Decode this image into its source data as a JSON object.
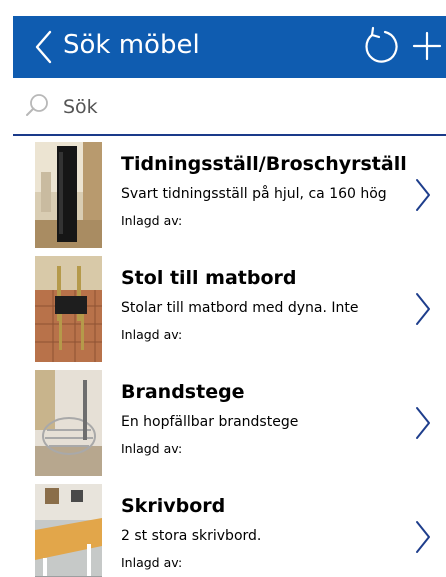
{
  "header": {
    "title": "Sök möbel",
    "bg_color": "#0f5cb0",
    "back_icon": "chevron-left-icon",
    "refresh_icon": "refresh-icon",
    "add_icon": "plus-icon"
  },
  "search": {
    "placeholder": "Sök",
    "value": ""
  },
  "items": [
    {
      "title": "Tidningsställ/Broschyrställ",
      "description": "Svart tidningsställ på hjul, ca 160 hög",
      "added_by": "Inlagd av:"
    },
    {
      "title": "Stol till matbord",
      "description": "Stolar till matbord med dyna. Inte",
      "added_by": "Inlagd av:"
    },
    {
      "title": "Brandstege",
      "description": "En hopfällbar brandstege",
      "added_by": "Inlagd av:"
    },
    {
      "title": "Skrivbord",
      "description": "2 st stora skrivbord.",
      "added_by": "Inlagd av:"
    }
  ]
}
